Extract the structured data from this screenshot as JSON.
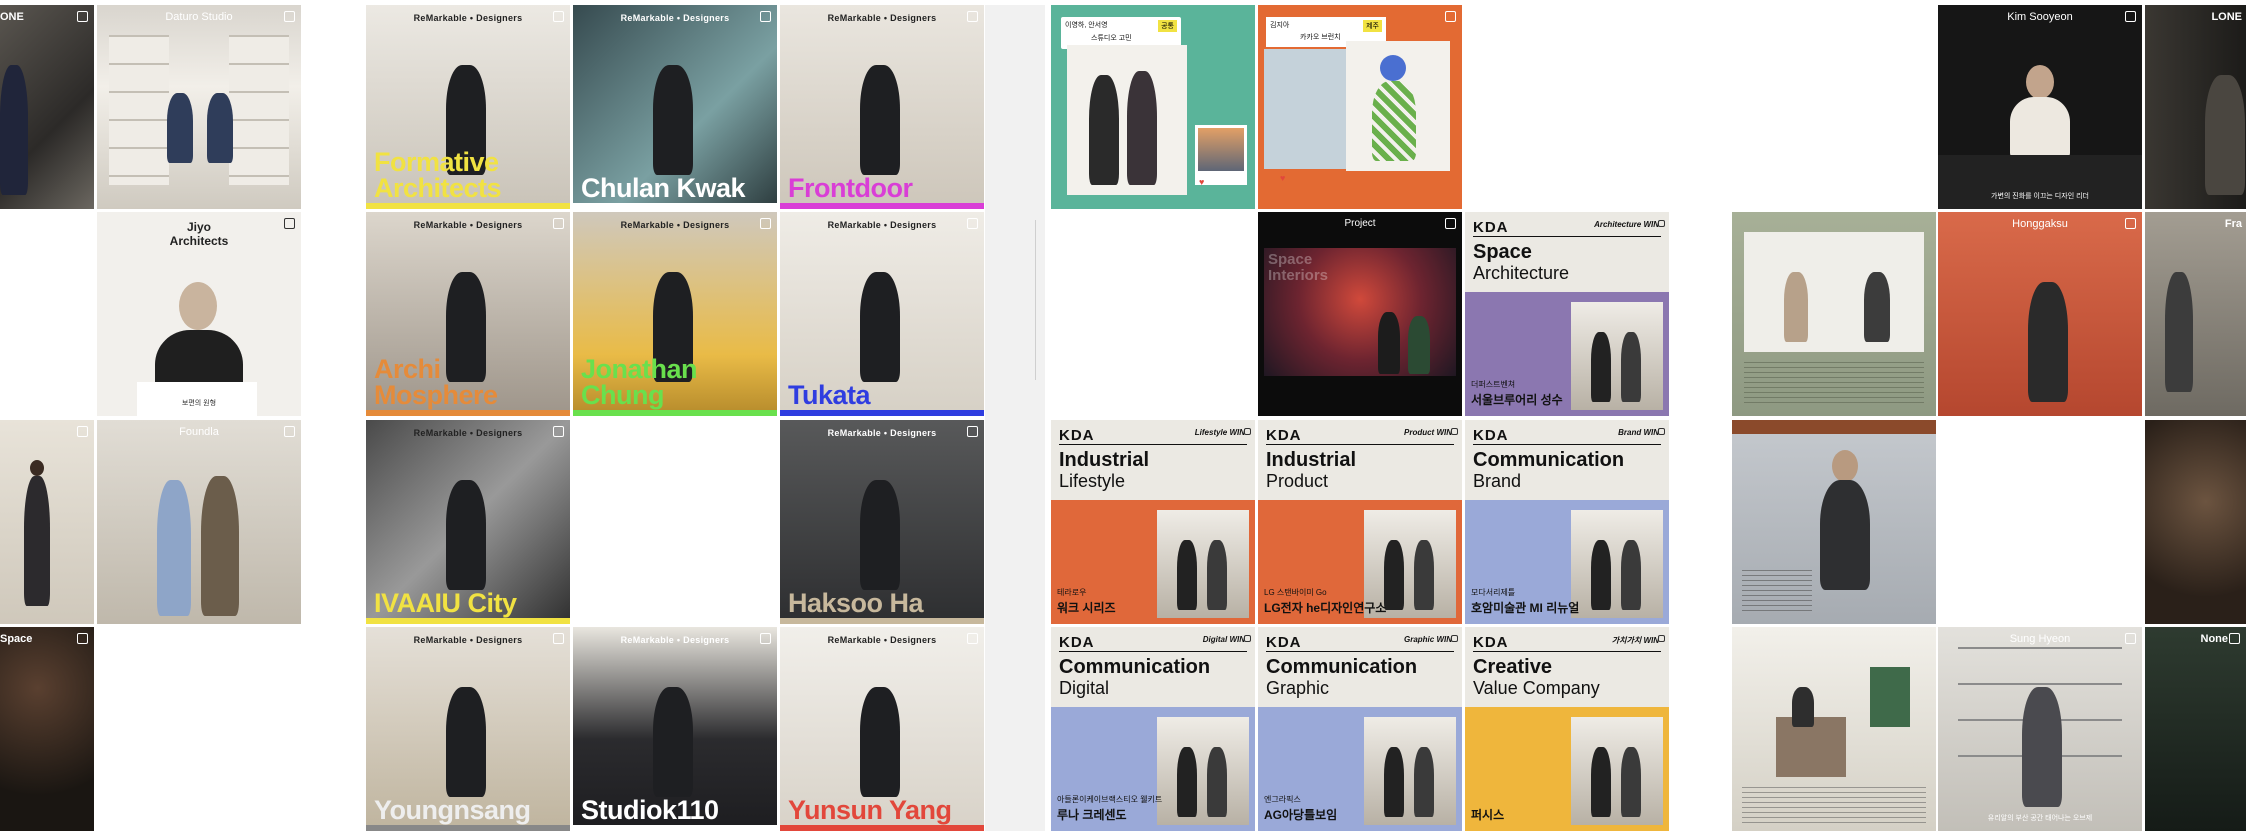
{
  "colors": {
    "kda_cream": "#ebe9e3",
    "kda_orange": "#e0683a",
    "kda_blue": "#9aa9d8",
    "kda_purple": "#8b77b0",
    "kda_yellow": "#efb63c",
    "teal": "#5ab49a"
  },
  "col1": {
    "tile_a": {
      "caption": "ONE"
    },
    "tile_b": {
      "caption": "Space"
    },
    "tile_c": {
      "caption": ""
    }
  },
  "col2": {
    "daturo": {
      "caption": "Daturo Studio"
    },
    "jiyo": {
      "caption": "Jiyo\nArchitects",
      "subtitle": "보편의 원형"
    },
    "foundla": {
      "caption": "Foundla"
    }
  },
  "remarkable": {
    "brand": "ReMarkable • Designers",
    "tiles": [
      {
        "name": "Formative\nArchitects",
        "bar": "#f1e242",
        "text_color": "#f1e242"
      },
      {
        "name": "Chulan Kwak",
        "bar": "#ffffff",
        "text_color": "#ffffff"
      },
      {
        "name": "Frontdoor",
        "bar": "#d93ed6",
        "text_color": "#d93ed6"
      },
      {
        "name": "Archi\nMosphere",
        "bar": "#e58b3a",
        "text_color": "#e58b3a"
      },
      {
        "name": "Jonathan\nChung",
        "bar": "#69e04d",
        "text_color": "#69e04d"
      },
      {
        "name": "Tukata",
        "bar": "#2f3de0",
        "text_color": "#2f3de0"
      },
      {
        "name": "IVAAIU City",
        "bar": "#f1e242",
        "text_color": "#f1e242"
      },
      {
        "name": "Haksoo Ha",
        "bar": "#c7b89c",
        "text_color": "#c7b89c"
      },
      {
        "name": "Youngnsang",
        "bar": "#888888",
        "text_color": "#eeeeee"
      },
      {
        "name": "Studiok110",
        "bar": "#ffffff",
        "text_color": "#ffffff"
      },
      {
        "name": "Yunsun Yang",
        "bar": "#e2473b",
        "text_color": "#e2473b"
      }
    ]
  },
  "social": {
    "teal_card": {
      "header": "이영하, 안서영",
      "sub": "스튜디오 고민",
      "tag": "공통"
    },
    "orange_card": {
      "header": "김지아",
      "sub": "카카오 브런치",
      "tag": "제주"
    },
    "project": {
      "caption": "Project",
      "title": "Space\nInteriors"
    }
  },
  "kda": {
    "logo": "KDA",
    "cards": [
      {
        "win": "Architecture WIN",
        "t1": "Space",
        "t2": "Architecture",
        "sub": "더퍼스트벤쳐",
        "name": "서울브루어리 성수",
        "block": "#8b77b0"
      },
      {
        "win": "Lifestyle WIN",
        "t1": "Industrial",
        "t2": "Lifestyle",
        "sub": "테라로우",
        "name": "워크 시리즈",
        "block": "#e0683a"
      },
      {
        "win": "Product WIN",
        "t1": "Industrial",
        "t2": "Product",
        "sub": "LG 스탠바이미 Go",
        "name": "LG전자 he디자인연구소",
        "block": "#e0683a"
      },
      {
        "win": "Brand WIN",
        "t1": "Communication",
        "t2": "Brand",
        "sub": "모다서리제틀",
        "name": "호암미술관 MI 리뉴얼",
        "block": "#9aa9d8"
      },
      {
        "win": "Digital WIN",
        "t1": "Communication",
        "t2": "Digital",
        "sub": "아들론이케이브랙스티오 웰키트",
        "name": "루나 크레센도",
        "block": "#9aa9d8"
      },
      {
        "win": "Graphic WIN",
        "t1": "Communication",
        "t2": "Graphic",
        "sub": "엔그라픽스",
        "name": "AG아당틀보임",
        "block": "#9aa9d8"
      },
      {
        "win": "가치가치 WIN",
        "t1": "Creative",
        "t2": "Value Company",
        "sub": "",
        "name": "퍼시스",
        "block": "#efb63c"
      }
    ]
  },
  "right": {
    "kim": {
      "caption": "Kim Sooyeon",
      "subtitle": "가변의 진화를 이끄는 디자인 리더"
    },
    "lone": {
      "caption": "LONE"
    },
    "honggaksu": {
      "caption": "Honggaksu"
    },
    "suna": {
      "caption": "Sung Hyeon",
      "subtitle": "유리알의 부산 공간 태어나는 오브제"
    },
    "none": {
      "caption": "None"
    },
    "fra": {
      "caption": "Fra"
    },
    "leftcol_article": {
      "caption": ""
    }
  }
}
